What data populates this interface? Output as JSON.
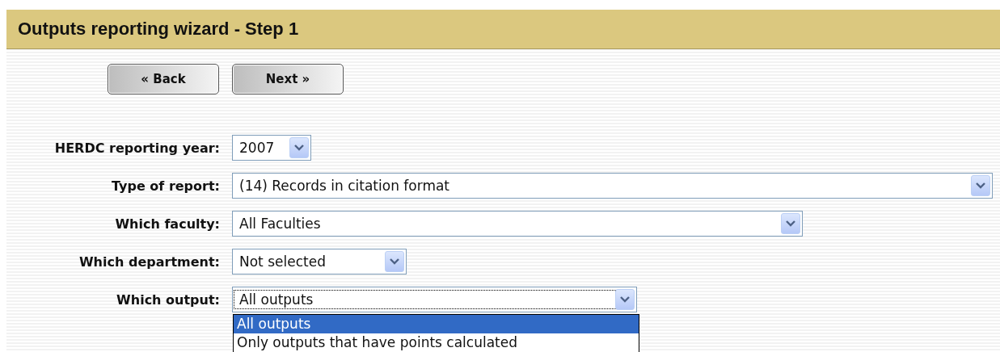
{
  "header": {
    "title": "Outputs reporting wizard - Step 1"
  },
  "buttons": [
    {
      "label": "« Back"
    },
    {
      "label": "Next »"
    }
  ],
  "fields": [
    {
      "label": "HERDC reporting year:",
      "value": "2007",
      "focused": false
    },
    {
      "label": "Type of report:",
      "value": "(14) Records in citation format",
      "focused": false
    },
    {
      "label": "Which faculty:",
      "value": "All Faculties",
      "focused": false
    },
    {
      "label": "Which department:",
      "value": "Not selected",
      "focused": false
    },
    {
      "label": "Which output:",
      "value": "All outputs",
      "focused": true,
      "expanded": true,
      "options": [
        {
          "label": "All outputs",
          "selected": true
        },
        {
          "label": "Only outputs that have points calculated",
          "selected": false
        }
      ]
    }
  ]
}
